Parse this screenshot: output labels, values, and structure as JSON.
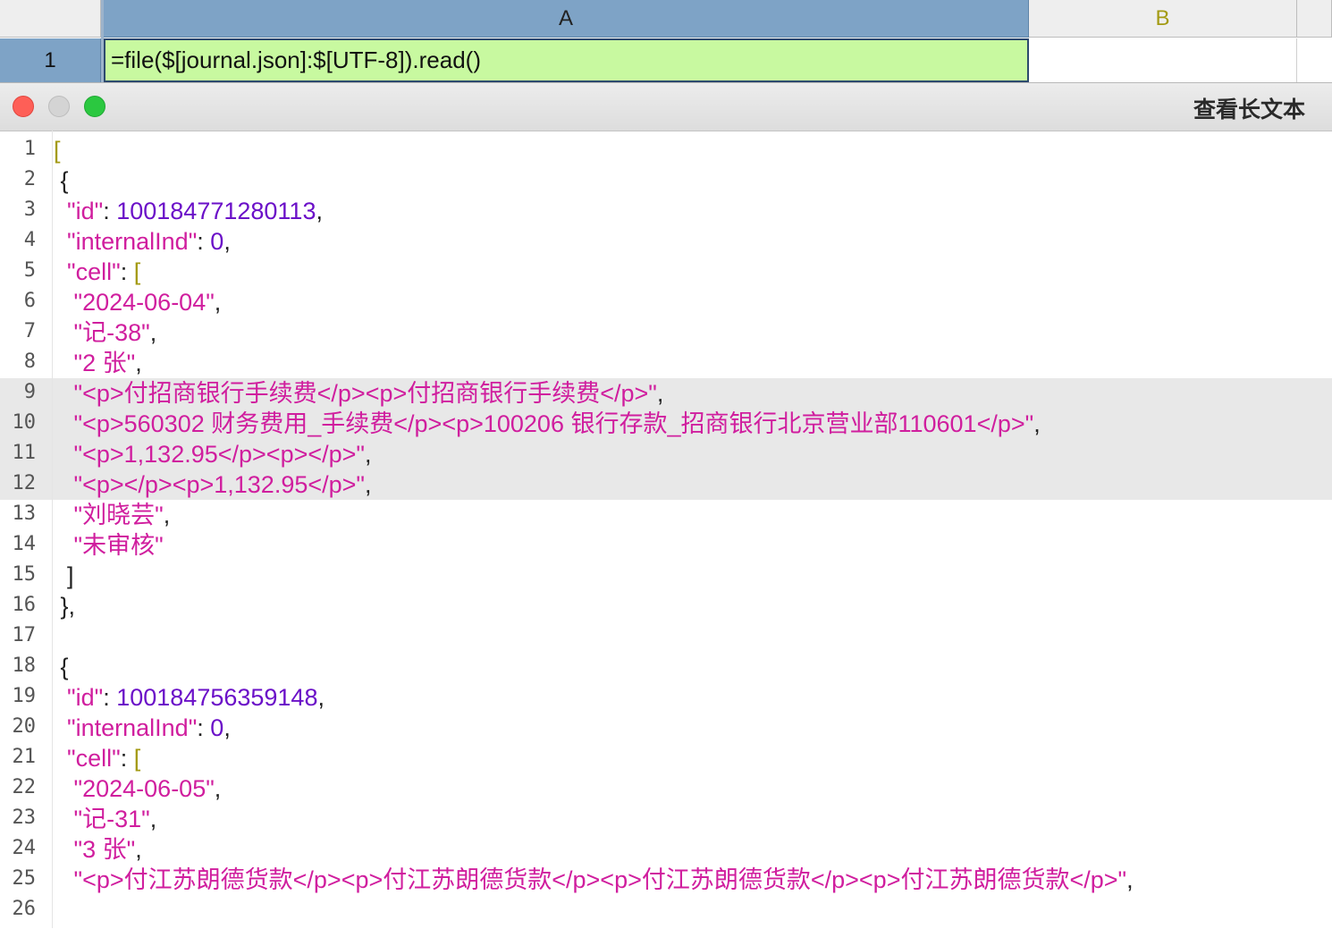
{
  "spreadsheet": {
    "columns": [
      "A",
      "B"
    ],
    "row_number": "1",
    "cell_a1": "=file($[journal.json]:$[UTF-8]).read()"
  },
  "dialog": {
    "title": "查看长文本"
  },
  "editor": {
    "highlighted_lines": [
      9,
      10,
      11,
      12
    ],
    "lines": [
      {
        "n": "1",
        "text": "["
      },
      {
        "n": "2",
        "text": " {"
      },
      {
        "n": "3",
        "text": "  \"id\": 100184771280113,"
      },
      {
        "n": "4",
        "text": "  \"internalInd\": 0,"
      },
      {
        "n": "5",
        "text": "  \"cell\": ["
      },
      {
        "n": "6",
        "text": "   \"2024-06-04\","
      },
      {
        "n": "7",
        "text": "   \"记-38\","
      },
      {
        "n": "8",
        "text": "   \"2 张\","
      },
      {
        "n": "9",
        "text": "   \"<p>付招商银行手续费</p><p>付招商银行手续费</p>\","
      },
      {
        "n": "10",
        "text": "   \"<p>560302 财务费用_手续费</p><p>100206 银行存款_招商银行北京营业部110601</p>\","
      },
      {
        "n": "11",
        "text": "   \"<p>1,132.95</p><p></p>\","
      },
      {
        "n": "12",
        "text": "   \"<p></p><p>1,132.95</p>\","
      },
      {
        "n": "13",
        "text": "   \"刘晓芸\","
      },
      {
        "n": "14",
        "text": "   \"未审核\""
      },
      {
        "n": "15",
        "text": "  ]"
      },
      {
        "n": "16",
        "text": " },"
      },
      {
        "n": "17",
        "text": ""
      },
      {
        "n": "18",
        "text": " {"
      },
      {
        "n": "19",
        "text": "  \"id\": 100184756359148,"
      },
      {
        "n": "20",
        "text": "  \"internalInd\": 0,"
      },
      {
        "n": "21",
        "text": "  \"cell\": ["
      },
      {
        "n": "22",
        "text": "   \"2024-06-05\","
      },
      {
        "n": "23",
        "text": "   \"记-31\","
      },
      {
        "n": "24",
        "text": "   \"3 张\","
      },
      {
        "n": "25",
        "text": "   \"<p>付江苏朗德货款</p><p>付江苏朗德货款</p><p>付江苏朗德货款</p><p>付江苏朗德货款</p>\","
      },
      {
        "n": "26",
        "text": ""
      }
    ]
  },
  "colors": {
    "string": "#d01e9e",
    "number": "#6b10c8",
    "bracket": "#a39a12",
    "cell_highlight": "#c8f9a0",
    "selected_header": "#7ea3c6"
  }
}
